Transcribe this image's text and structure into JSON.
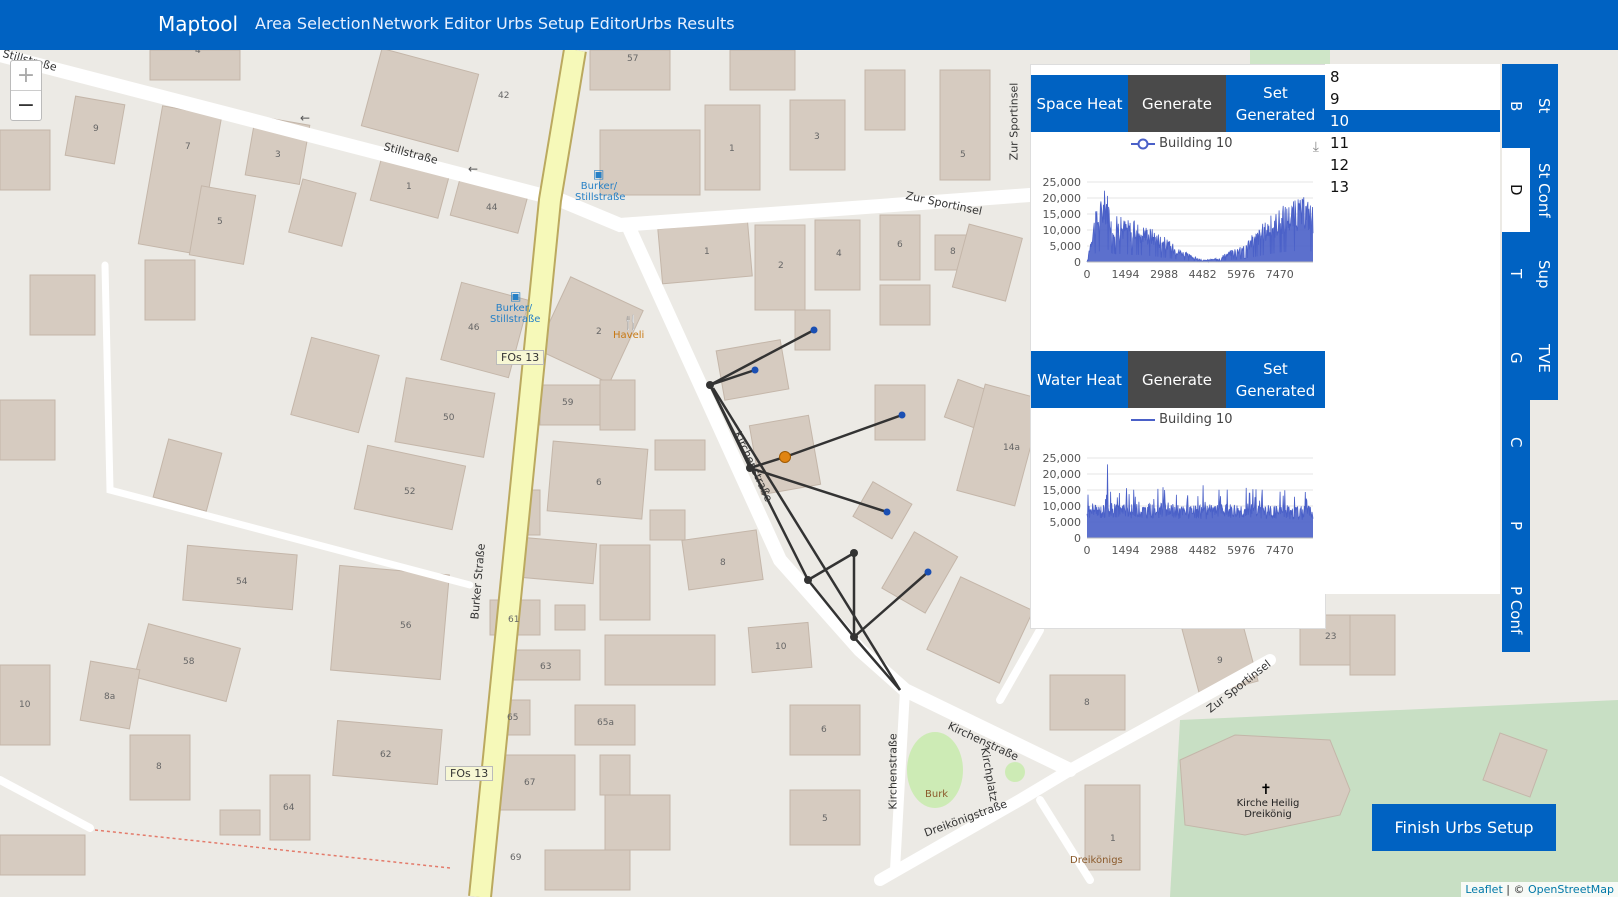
{
  "nav": {
    "brand": "Maptool",
    "links": [
      "Area Selection",
      "Network Editor",
      "Urbs Setup Editor",
      "Urbs Results"
    ]
  },
  "map": {
    "zoom_in": "+",
    "zoom_out": "−",
    "street_labels": [
      "Stillstraße",
      "Stillstraße",
      "Zur Sportinsel",
      "Zur Sportinsel",
      "Zur Sportinsel",
      "Kirchenstraße",
      "Kirchenstraße",
      "Kirchenstraße",
      "Burker Straße",
      "FOs 13",
      "FOs 13",
      "Dreikönigstraße",
      "Kirchplatz"
    ],
    "poi_labels": [
      "Burker/ Stillstraße",
      "Burker/ Stillstraße",
      "Haveli",
      "Burk",
      "Kirche Heilig Dreikönig",
      "Dreikönigs"
    ],
    "house_numbers": [
      "4",
      "42",
      "9",
      "7",
      "3",
      "1",
      "44",
      "57",
      "1",
      "3",
      "5",
      "5",
      "1",
      "2",
      "4",
      "6",
      "8",
      "46",
      "2",
      "50",
      "59",
      "6",
      "8",
      "52",
      "54",
      "56",
      "58",
      "61",
      "63",
      "10",
      "65",
      "65a",
      "67",
      "62",
      "64",
      "10",
      "8a",
      "8",
      "69",
      "6",
      "5",
      "14a",
      "8",
      "23",
      "9",
      "1"
    ]
  },
  "panel": {
    "space_heat": {
      "label": "Space Heat",
      "generate": "Generate",
      "set_generated": "Set Generated",
      "legend": "Building 10"
    },
    "water_heat": {
      "label": "Water Heat",
      "generate": "Generate",
      "set_generated": "Set Generated",
      "legend": "Building 10"
    }
  },
  "chart_data": [
    {
      "type": "line",
      "title": "",
      "series": [
        {
          "name": "Building 10"
        }
      ],
      "x_ticks": [
        "0",
        "1494",
        "2988",
        "4482",
        "5976",
        "7470"
      ],
      "y_ticks": [
        "0",
        "5,000",
        "10,000",
        "15,000",
        "20,000",
        "25,000"
      ],
      "xlim": [
        0,
        8760
      ],
      "ylim": [
        0,
        25000
      ],
      "series_color": "#4a60c8",
      "approx_profile": [
        {
          "x": 0,
          "y": 0
        },
        {
          "x": 250,
          "y": 12000
        },
        {
          "x": 500,
          "y": 17000
        },
        {
          "x": 750,
          "y": 21000
        },
        {
          "x": 1000,
          "y": 13000
        },
        {
          "x": 1500,
          "y": 12000
        },
        {
          "x": 2000,
          "y": 11000
        },
        {
          "x": 2500,
          "y": 9500
        },
        {
          "x": 3000,
          "y": 7000
        },
        {
          "x": 3500,
          "y": 4000
        },
        {
          "x": 4000,
          "y": 2000
        },
        {
          "x": 4500,
          "y": 500
        },
        {
          "x": 5000,
          "y": 1000
        },
        {
          "x": 5500,
          "y": 3000
        },
        {
          "x": 6000,
          "y": 5000
        },
        {
          "x": 6500,
          "y": 8000
        },
        {
          "x": 7000,
          "y": 12000
        },
        {
          "x": 7500,
          "y": 15000
        },
        {
          "x": 8000,
          "y": 17000
        },
        {
          "x": 8500,
          "y": 18000
        },
        {
          "x": 8760,
          "y": 16000
        }
      ]
    },
    {
      "type": "line",
      "title": "",
      "series": [
        {
          "name": "Building 10"
        }
      ],
      "x_ticks": [
        "0",
        "1494",
        "2988",
        "4482",
        "5976",
        "7470"
      ],
      "y_ticks": [
        "0",
        "5,000",
        "10,000",
        "15,000",
        "20,000",
        "25,000"
      ],
      "xlim": [
        0,
        8760
      ],
      "ylim": [
        0,
        25000
      ],
      "series_color": "#4a60c8",
      "approx_profile": [
        {
          "x": 0,
          "y": 8000
        },
        {
          "x": 1000,
          "y": 9000
        },
        {
          "x": 2000,
          "y": 8500
        },
        {
          "x": 3000,
          "y": 9000
        },
        {
          "x": 4000,
          "y": 8000
        },
        {
          "x": 5000,
          "y": 8500
        },
        {
          "x": 6000,
          "y": 9000
        },
        {
          "x": 7000,
          "y": 8500
        },
        {
          "x": 8760,
          "y": 8000
        }
      ],
      "peaks": [
        {
          "x": 800,
          "y": 23000
        },
        {
          "x": 3000,
          "y": 15000
        },
        {
          "x": 4500,
          "y": 16500
        },
        {
          "x": 6300,
          "y": 14000
        }
      ]
    }
  ],
  "list": {
    "items": [
      "8",
      "9",
      "10",
      "11",
      "12",
      "13"
    ],
    "selected": "10"
  },
  "side_tabs": {
    "left": [
      "B",
      "D",
      "T",
      "G",
      "C",
      "P",
      "P Conf"
    ],
    "right": [
      "St",
      "St Conf",
      "Sup",
      "TVE"
    ],
    "selected": "D"
  },
  "finish_button": "Finish Urbs Setup",
  "attribution": {
    "leaflet": "Leaflet",
    "sep": " | © ",
    "osm": "OpenStreetMap"
  }
}
